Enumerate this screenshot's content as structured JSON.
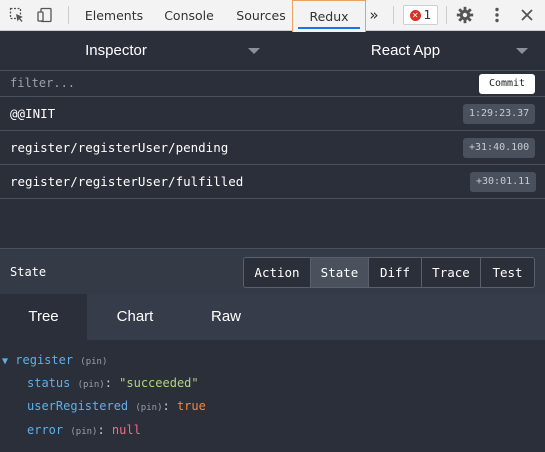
{
  "devtools": {
    "tabs": [
      "Elements",
      "Console",
      "Sources",
      "Redux"
    ],
    "active_tab": "Redux",
    "more_label": "»",
    "error_count": "1",
    "colors": {
      "active_outline": "#e8a35f",
      "active_underline": "#1a73e8",
      "error": "#d93025"
    }
  },
  "header": {
    "left_select": "Inspector",
    "right_select": "React App"
  },
  "filter": {
    "placeholder": "filter...",
    "commit_label": "Commit"
  },
  "actions": [
    {
      "name": "@@INIT",
      "time": "1:29:23.37"
    },
    {
      "name": "register/registerUser/pending",
      "time": "+31:40.100"
    },
    {
      "name": "register/registerUser/fulfilled",
      "time": "+30:01.11"
    }
  ],
  "pane": {
    "title": "State",
    "buttons": [
      "Action",
      "State",
      "Diff",
      "Trace",
      "Test"
    ],
    "active_button": "State"
  },
  "view_tabs": {
    "items": [
      "Tree",
      "Chart",
      "Raw"
    ],
    "active": "Tree"
  },
  "tree": {
    "arrow": "▼",
    "root_key": "register",
    "pin_label": "(pin)",
    "fields": [
      {
        "key": "status",
        "value": "\"succeeded\"",
        "type": "string"
      },
      {
        "key": "userRegistered",
        "value": "true",
        "type": "boolean"
      },
      {
        "key": "error",
        "value": "null",
        "type": "null"
      }
    ],
    "colors": {
      "key": "#5eb0e8",
      "string": "#b5d27d",
      "boolean": "#f6863f",
      "null": "#f06b8a"
    }
  }
}
